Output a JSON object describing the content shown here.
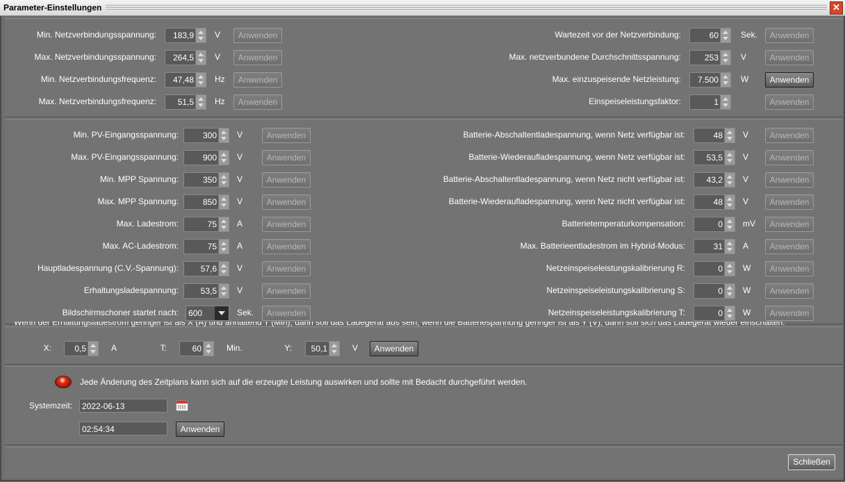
{
  "window": {
    "title": "Parameter-Einstellungen",
    "close_glyph": "✕"
  },
  "grid_section": {
    "left": [
      {
        "label": "Min. Netzverbindungsspannung:",
        "value": "183,9",
        "unit": "V",
        "button": "Anwenden"
      },
      {
        "label": "Max. Netzverbindungsspannung:",
        "value": "264,5",
        "unit": "V",
        "button": "Anwenden"
      },
      {
        "label": "Min. Netzverbindungsfrequenz:",
        "value": "47,48",
        "unit": "Hz",
        "button": "Anwenden"
      },
      {
        "label": "Max. Netzverbindungsfrequenz:",
        "value": "51,5",
        "unit": "Hz",
        "button": "Anwenden"
      }
    ],
    "right": [
      {
        "label": "Wartezeit vor der Netzverbindung:",
        "value": "60",
        "unit": "Sek.",
        "button": "Anwenden"
      },
      {
        "label": "Max. netzverbundene Durchschnittsspannung:",
        "value": "253",
        "unit": "V",
        "button": "Anwenden"
      },
      {
        "label": "Max. einzuspeisende Netzleistung:",
        "value": "7.500",
        "unit": "W",
        "button": "Anwenden"
      },
      {
        "label": "Einspeiseleistungsfaktor:",
        "value": "1",
        "unit": "",
        "button": "Anwenden"
      }
    ]
  },
  "pv_section": {
    "left": [
      {
        "label": "Min. PV-Eingangsspannung:",
        "value": "300",
        "unit": "V",
        "button": "Anwenden"
      },
      {
        "label": "Max. PV-Eingangsspannung:",
        "value": "900",
        "unit": "V",
        "button": "Anwenden"
      },
      {
        "label": "Min. MPP Spannung:",
        "value": "350",
        "unit": "V",
        "button": "Anwenden"
      },
      {
        "label": "Max. MPP Spannung:",
        "value": "850",
        "unit": "V",
        "button": "Anwenden"
      },
      {
        "label": "Max. Ladestrom:",
        "value": "75",
        "unit": "A",
        "button": "Anwenden"
      },
      {
        "label": "Max. AC-Ladestrom:",
        "value": "75",
        "unit": "A",
        "button": "Anwenden"
      },
      {
        "label": "Hauptladespannung (C.V.-Spannung):",
        "value": "57,6",
        "unit": "V",
        "button": "Anwenden"
      },
      {
        "label": "Erhaltungsladespannung:",
        "value": "53,5",
        "unit": "V",
        "button": "Anwenden"
      }
    ],
    "screensaver": {
      "label": "Bildschirmschoner startet nach:",
      "value": "600",
      "unit": "Sek.",
      "button": "Anwenden"
    },
    "right": [
      {
        "label": "Batterie-Abschaltentladespannung, wenn Netz verfügbar ist:",
        "value": "48",
        "unit": "V",
        "button": "Anwenden"
      },
      {
        "label": "Batterie-Wiederaufladespannung, wenn Netz verfügbar ist:",
        "value": "53,5",
        "unit": "V",
        "button": "Anwenden"
      },
      {
        "label": "Batterie-Abschaltentladespannung, wenn Netz nicht verfügbar ist:",
        "value": "43,2",
        "unit": "V",
        "button": "Anwenden"
      },
      {
        "label": "Batterie-Wiederaufladespannung, wenn Netz nicht verfügbar ist:",
        "value": "48",
        "unit": "V",
        "button": "Anwenden"
      },
      {
        "label": "Batterietemperaturkompensation:",
        "value": "0",
        "unit": "mV",
        "button": "Anwenden"
      },
      {
        "label": "Max. Batterieentladestrom im Hybrid-Modus:",
        "value": "31",
        "unit": "A",
        "button": "Anwenden"
      },
      {
        "label": "Netzeinspeiseleistungskalibrierung R:",
        "value": "0",
        "unit": "W",
        "button": "Anwenden"
      },
      {
        "label": "Netzeinspeiseleistungskalibrierung S:",
        "value": "0",
        "unit": "W",
        "button": "Anwenden"
      },
      {
        "label": "Netzeinspeiseleistungskalibrierung T:",
        "value": "0",
        "unit": "W",
        "button": "Anwenden"
      }
    ]
  },
  "xty_section": {
    "clipped_text": "Wenn der Erhaltungsladestrom geringer ist als X (A) und anhaltend T (Min), dann soll das Ladegerät aus sein; wenn die Batteriespannung geringer ist als Y (V), dann soll sich das Ladegerät wieder einschalten.",
    "x": {
      "label": "X:",
      "value": "0,5",
      "unit": "A"
    },
    "t": {
      "label": "T:",
      "value": "60",
      "unit": "Min."
    },
    "y": {
      "label": "Y:",
      "value": "50,1",
      "unit": "V"
    },
    "button": "Anwenden"
  },
  "time_section": {
    "warning": "Jede Änderung des Zeitplans kann sich auf die erzeugte Leistung auswirken und sollte mit Bedacht durchgeführt werden.",
    "systemzeit_label": "Systemzeit:",
    "date": "2022-06-13",
    "time": "02:54:34",
    "button": "Anwenden"
  },
  "footer": {
    "close_button": "Schließen"
  }
}
